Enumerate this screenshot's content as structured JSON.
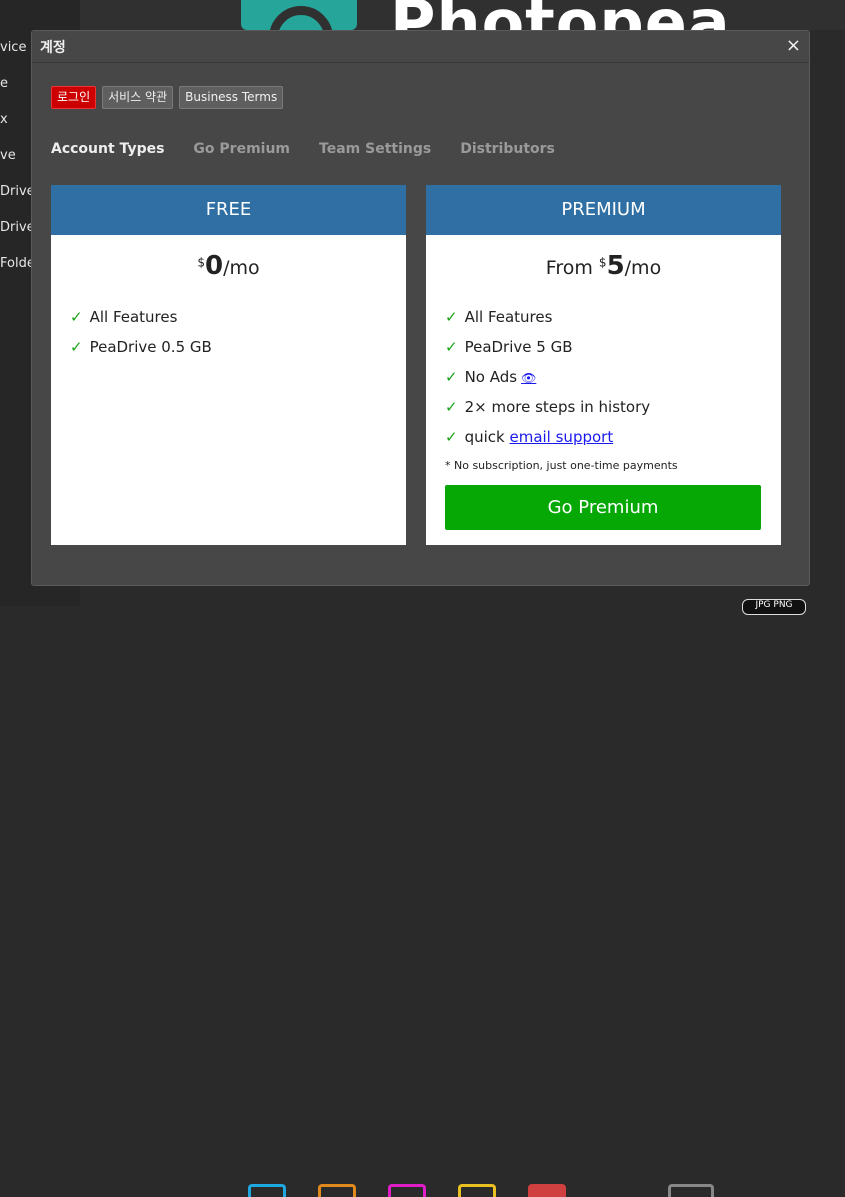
{
  "background": {
    "sidebar_items": [
      "vice",
      "e",
      "x",
      "ve",
      "Drive",
      "Drive",
      "Folde"
    ],
    "logo_text": "Photopea",
    "status_badge": "JPG  PNG"
  },
  "dialog": {
    "title": "계정",
    "close_symbol": "×",
    "buttons": {
      "login": "로그인",
      "terms": "서비스 약관",
      "business_terms": "Business Terms"
    },
    "tabs": [
      "Account Types",
      "Go Premium",
      "Team Settings",
      "Distributors"
    ],
    "active_tab": "Account Types",
    "free": {
      "title": "FREE",
      "currency": "$",
      "amount": "0",
      "period": "/mo",
      "features": [
        "All Features",
        "PeaDrive 0.5 GB"
      ]
    },
    "premium": {
      "title": "PREMIUM",
      "prefix": "From ",
      "currency": "$",
      "amount": "5",
      "period": "/mo",
      "features": {
        "f1": "All Features",
        "f2": "PeaDrive 5 GB",
        "f3": "No Ads",
        "f4": "2× more steps in history",
        "f5_prefix": "quick ",
        "f5_link": "email support"
      },
      "eye_icon": "👁",
      "note": "* No subscription, just one-time payments",
      "cta": "Go Premium"
    },
    "check_mark": "✓"
  },
  "colors": {
    "card_header": "#2f6fa3",
    "cta_green": "#05a805",
    "login_red": "#cc0000",
    "check_green": "#1aa31a"
  }
}
